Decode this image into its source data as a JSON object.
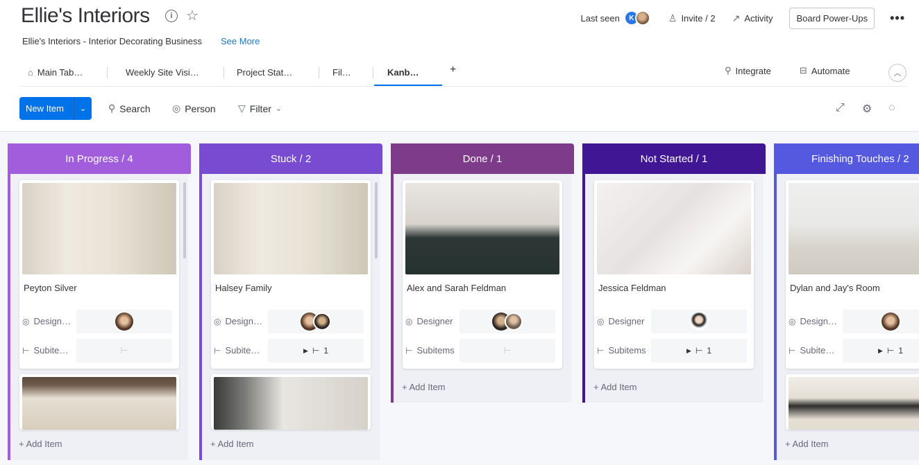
{
  "header": {
    "title": "Ellie's Interiors",
    "subtitle": "Ellie's Interiors - Interior Decorating Business",
    "see_more": "See More",
    "last_seen": "Last seen",
    "invite": "Invite / 2",
    "activity": "Activity",
    "power_ups": "Board Power-Ups",
    "more": "•••"
  },
  "tabs": [
    {
      "label": "Main Tab…"
    },
    {
      "label": "Weekly Site Visi…"
    },
    {
      "label": "Project Stat…"
    },
    {
      "label": "Fil…"
    },
    {
      "label": "Kanb…"
    }
  ],
  "tab_actions": {
    "add": "+",
    "integrate": "Integrate",
    "automate": "Automate"
  },
  "toolbar": {
    "new_item": "New Item",
    "search": "Search",
    "person": "Person",
    "filter": "Filter"
  },
  "columns": [
    {
      "title": "In Progress / 4",
      "color": "#a25ddc",
      "cards": [
        {
          "name": "Peyton Silver",
          "designer_label": "Design…",
          "subitems_label": "Subite…",
          "subitems_count": ""
        }
      ],
      "add_item": "+ Add Item"
    },
    {
      "title": "Stuck / 2",
      "color": "#784bd1",
      "cards": [
        {
          "name": "Halsey Family",
          "designer_label": "Design…",
          "subitems_label": "Subite…",
          "subitems_count": "1"
        }
      ],
      "add_item": "+ Add Item"
    },
    {
      "title": "Done / 1",
      "color": "#7e3b8a",
      "cards": [
        {
          "name": "Alex and Sarah Feldman",
          "designer_label": "Designer",
          "subitems_label": "Subitems",
          "subitems_count": ""
        }
      ],
      "add_item": "+ Add Item"
    },
    {
      "title": "Not Started / 1",
      "color": "#401694",
      "cards": [
        {
          "name": "Jessica Feldman",
          "designer_label": "Designer",
          "subitems_label": "Subitems",
          "subitems_count": "1"
        }
      ],
      "add_item": "+ Add Item"
    },
    {
      "title": "Finishing Touches / 2",
      "color": "#5559df",
      "cards": [
        {
          "name": "Dylan and Jay's Room",
          "designer_label": "Design…",
          "subitems_label": "Subite…",
          "subitems_count": "1"
        }
      ],
      "add_item": "+ Add Item"
    }
  ]
}
